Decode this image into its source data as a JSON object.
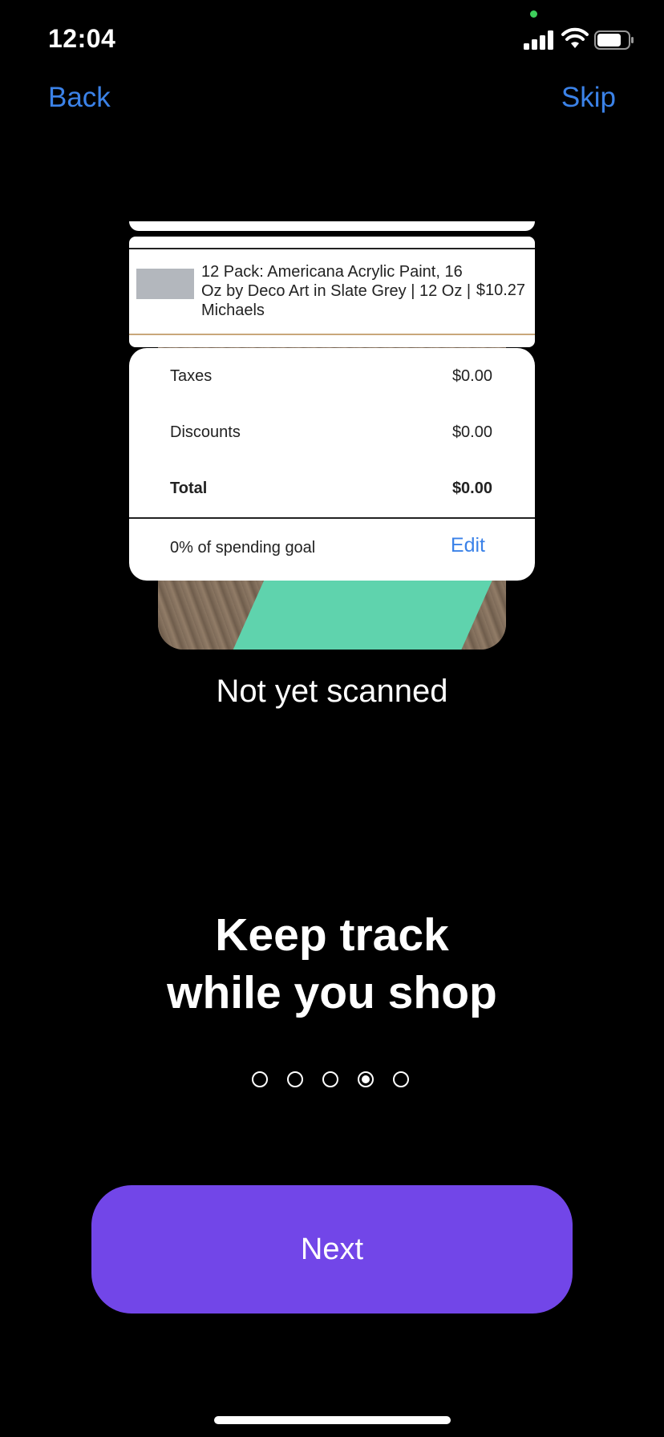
{
  "status_bar": {
    "time": "12:04",
    "icons": [
      "signal-icon",
      "wifi-icon",
      "battery-icon"
    ]
  },
  "nav": {
    "back_label": "Back",
    "skip_label": "Skip"
  },
  "receipt_item": {
    "title": "12 Pack: Americana Acrylic Paint, 16 Oz by Deco Art in Slate Grey | 12 Oz | Michaels",
    "price": "$10.27"
  },
  "summary": {
    "rows": [
      {
        "label": "Taxes",
        "value": "$0.00"
      },
      {
        "label": "Discounts",
        "value": "$0.00"
      },
      {
        "label": "Total",
        "value": "$0.00"
      }
    ],
    "goal_label": "0% of spending goal",
    "edit_label": "Edit"
  },
  "scan_status": "Not yet scanned",
  "headline": {
    "line1": "Keep track",
    "line2": "while you shop"
  },
  "pagination": {
    "total": 5,
    "current": 4
  },
  "next_label": "Next",
  "colors": {
    "accent_blue": "#3b82e8",
    "button_purple": "#7246e8",
    "background": "#000000"
  }
}
